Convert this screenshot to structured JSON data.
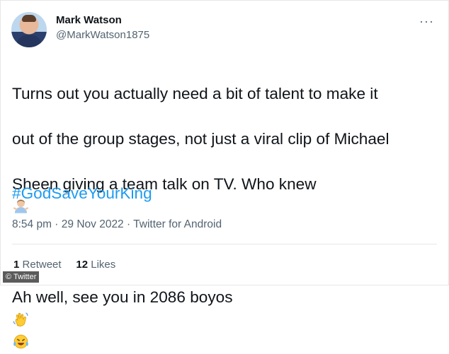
{
  "user": {
    "name": "Mark Watson",
    "handle": "@MarkWatson1875"
  },
  "menu": {
    "more_label": "···"
  },
  "tweet": {
    "line1": "Turns out you actually need a bit of talent to make it",
    "line2": "out of the group stages, not just a viral clip of Michael",
    "line3": "Sheen giving a team talk on TV. Who knew",
    "line4": "Ah well, see you in 2086 boyos",
    "hashtag": "#GodSaveYourKing",
    "meta": "8:54 pm · 29 Nov 2022 · Twitter for Android"
  },
  "stats": {
    "retweets_count": "1",
    "retweets_label": "Retweet",
    "likes_count": "12",
    "likes_label": "Likes"
  },
  "watermark": {
    "text": "© Twitter"
  },
  "icons": {
    "avatar": "profile-photo",
    "emoji1": "man-shrugging",
    "emoji2": "waving-hand",
    "emoji3": "face-with-tears-of-joy"
  }
}
